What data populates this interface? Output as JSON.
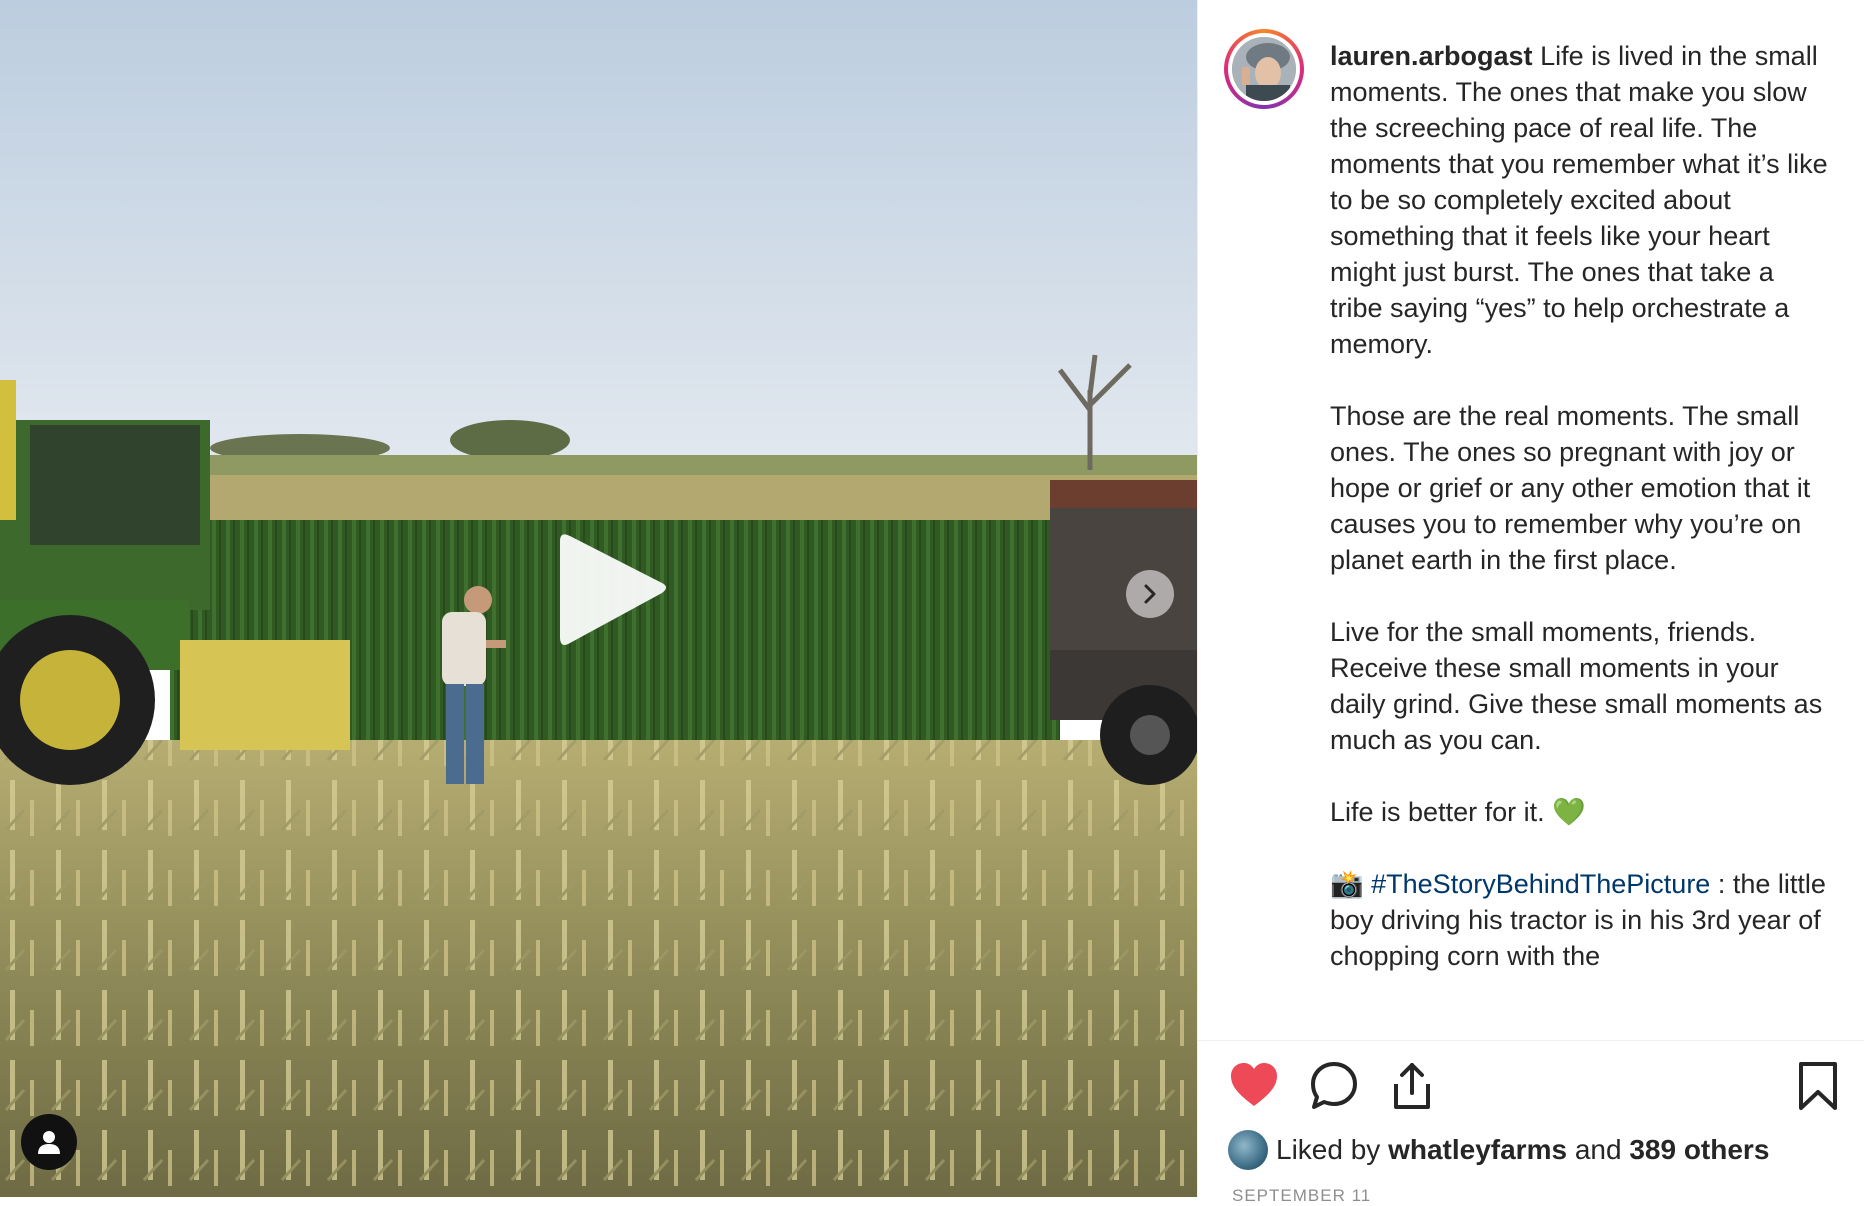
{
  "post": {
    "username": "lauren.arbogast",
    "caption_paragraphs": [
      "Life is lived in the small moments. The ones that make you slow the screeching pace of real life. The moments that you remember what it’s like to be so completely excited about something that it feels like your heart might just burst. The ones that take a tribe saying “yes” to help orchestrate a memory.",
      "Those are the real moments. The small ones. The ones so pregnant with joy or hope or grief or any other emotion that it causes you to remember why you’re on planet earth in the first place.",
      "Live for the small moments, friends. Receive these small moments in your daily grind. Give these small moments as much as you can.",
      "Life is better for it."
    ],
    "green_heart": "💚",
    "camera_emoji": "📸",
    "hashtag": "#TheStoryBehindThePicture",
    "story_text": " : the little boy driving his tractor is in his 3rd year of chopping corn with the",
    "likes": {
      "prefix": "Liked by",
      "user": "whatleyfarms",
      "conjunction": "and",
      "others": "389 others"
    },
    "date": "SEPTEMBER 11"
  },
  "icons": {
    "like": "heart-icon",
    "comment": "comment-icon",
    "share": "share-icon",
    "save": "bookmark-icon",
    "play": "play-icon",
    "next": "chevron-right-icon",
    "tag": "user-tag-icon"
  },
  "colors": {
    "like_active": "#ed4956",
    "hashtag": "#00376b",
    "text": "#262626",
    "muted": "#8e8e8e"
  }
}
